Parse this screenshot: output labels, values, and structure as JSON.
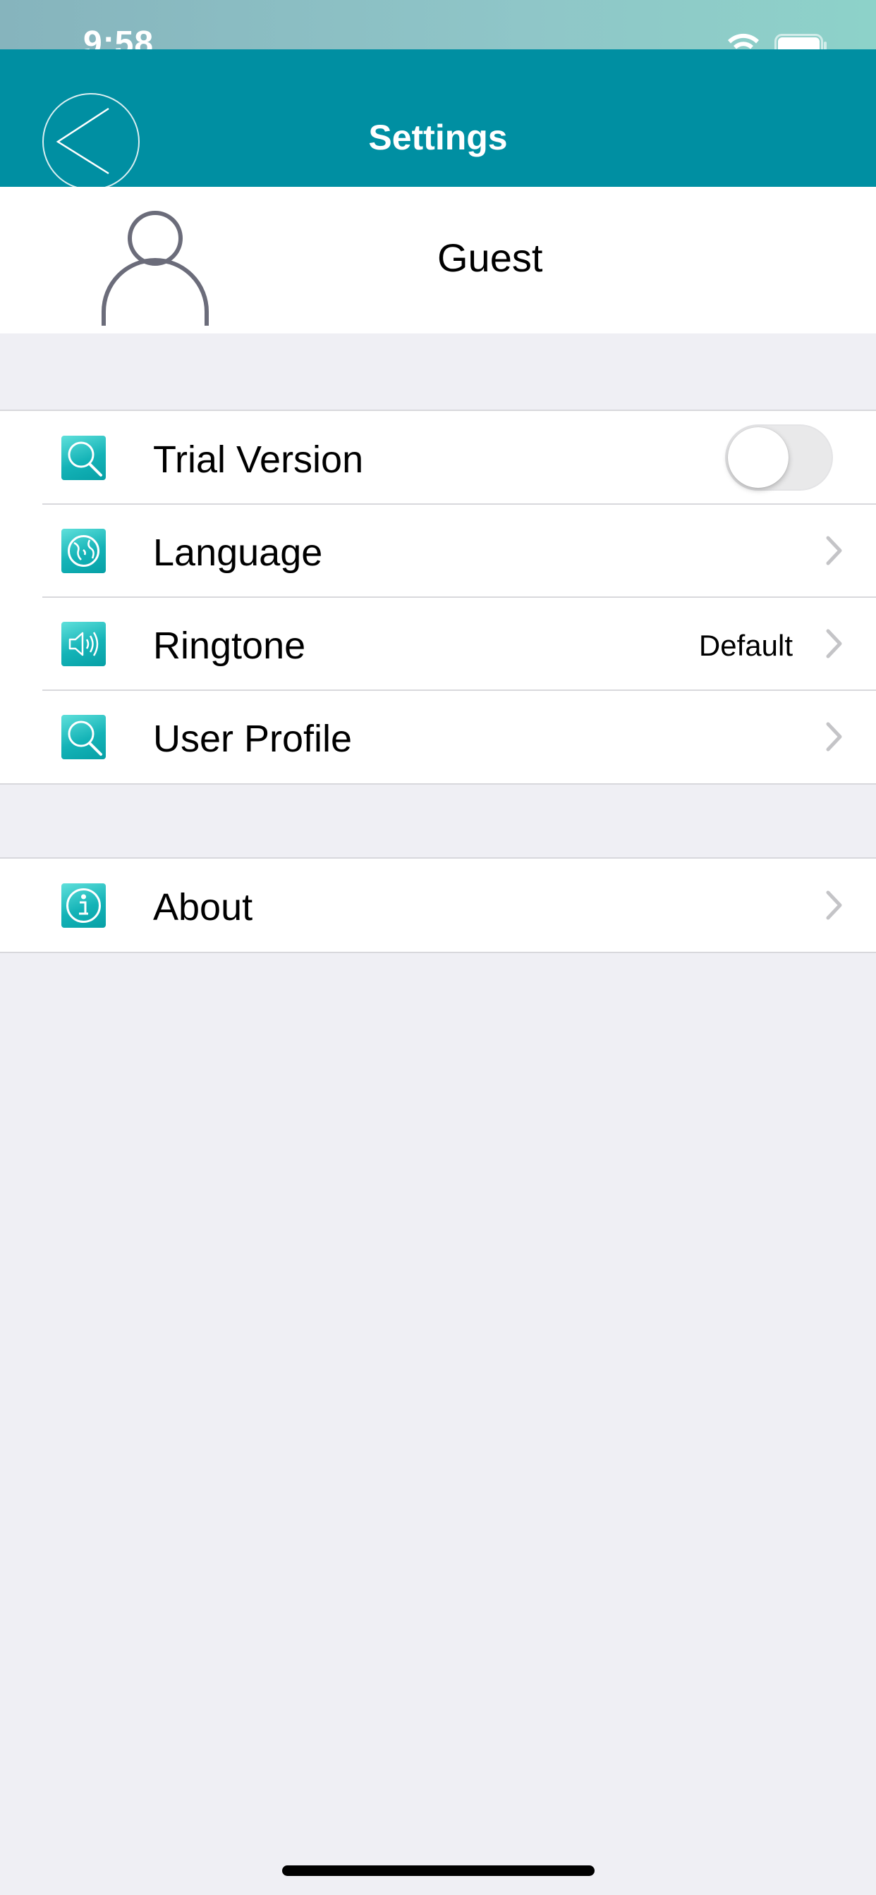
{
  "status_bar": {
    "time": "9:58"
  },
  "nav": {
    "title": "Settings",
    "back_icon": "chevron-left-circle-icon"
  },
  "profile": {
    "name": "Guest",
    "avatar_icon": "person-outline-icon"
  },
  "settings": [
    {
      "label": "Trial Version",
      "icon": "search-icon",
      "control": "toggle",
      "toggle_on": false
    },
    {
      "label": "Language",
      "icon": "globe-icon",
      "control": "chevron"
    },
    {
      "label": "Ringtone",
      "icon": "speaker-icon",
      "value": "Default",
      "control": "chevron"
    },
    {
      "label": "User Profile",
      "icon": "search-icon",
      "control": "chevron"
    }
  ],
  "about": {
    "label": "About",
    "icon": "info-icon",
    "control": "chevron"
  },
  "colors": {
    "nav_background": "#008fa2",
    "page_background": "#efeff4",
    "icon_accent": "#14b3b7",
    "chevron": "#c4c4c7"
  }
}
